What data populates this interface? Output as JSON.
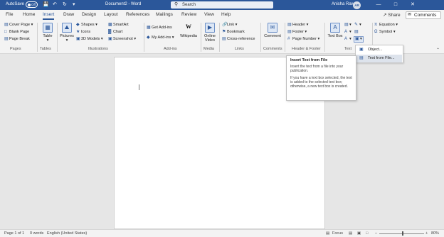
{
  "titlebar": {
    "autosave_label": "AutoSave",
    "autosave_state": "Off",
    "doc_title": "Document2 - Word",
    "search_placeholder": "Search",
    "user_name": "Anisha Rawat",
    "user_initials": "AR"
  },
  "tabs": [
    "File",
    "Home",
    "Insert",
    "Draw",
    "Design",
    "Layout",
    "References",
    "Mailings",
    "Review",
    "View",
    "Help"
  ],
  "active_tab": "Insert",
  "share_label": "Share",
  "comments_label": "Comments",
  "ribbon": {
    "pages": {
      "cover_page": "Cover Page",
      "blank_page": "Blank Page",
      "page_break": "Page Break",
      "label": "Pages"
    },
    "tables": {
      "table": "Table",
      "label": "Tables"
    },
    "illustrations": {
      "pictures": "Pictures",
      "shapes": "Shapes",
      "icons": "Icons",
      "models3d": "3D Models",
      "smartart": "SmartArt",
      "chart": "Chart",
      "screenshot": "Screenshot",
      "label": "Illustrations"
    },
    "addins": {
      "get_addins": "Get Add-ins",
      "my_addins": "My Add-ins",
      "wikipedia": "Wikipedia",
      "label": "Add-ins"
    },
    "media": {
      "online_video": "Online Video",
      "label": "Media"
    },
    "links": {
      "link": "Link",
      "bookmark": "Bookmark",
      "cross_reference": "Cross-reference",
      "label": "Links"
    },
    "comments": {
      "comment": "Comment",
      "label": "Comments"
    },
    "header_footer": {
      "header": "Header",
      "footer": "Footer",
      "page_number": "Page Number",
      "label": "Header & Footer"
    },
    "text": {
      "text_box": "Text Box",
      "label": "Text"
    },
    "symbols": {
      "equation": "Equation",
      "symbol": "Symbol"
    }
  },
  "dropdown": {
    "object": "Object...",
    "text_from_file": "Text from File..."
  },
  "tooltip": {
    "title": "Insert Text from File",
    "line1": "Insert the text from a file into your publication.",
    "line2": "If you have a text box selected, the text is added to the selected text box; otherwise, a new text box is created."
  },
  "statusbar": {
    "page": "Page 1 of 1",
    "words": "0 words",
    "language": "English (United States)",
    "focus": "Focus",
    "zoom": "80%"
  }
}
